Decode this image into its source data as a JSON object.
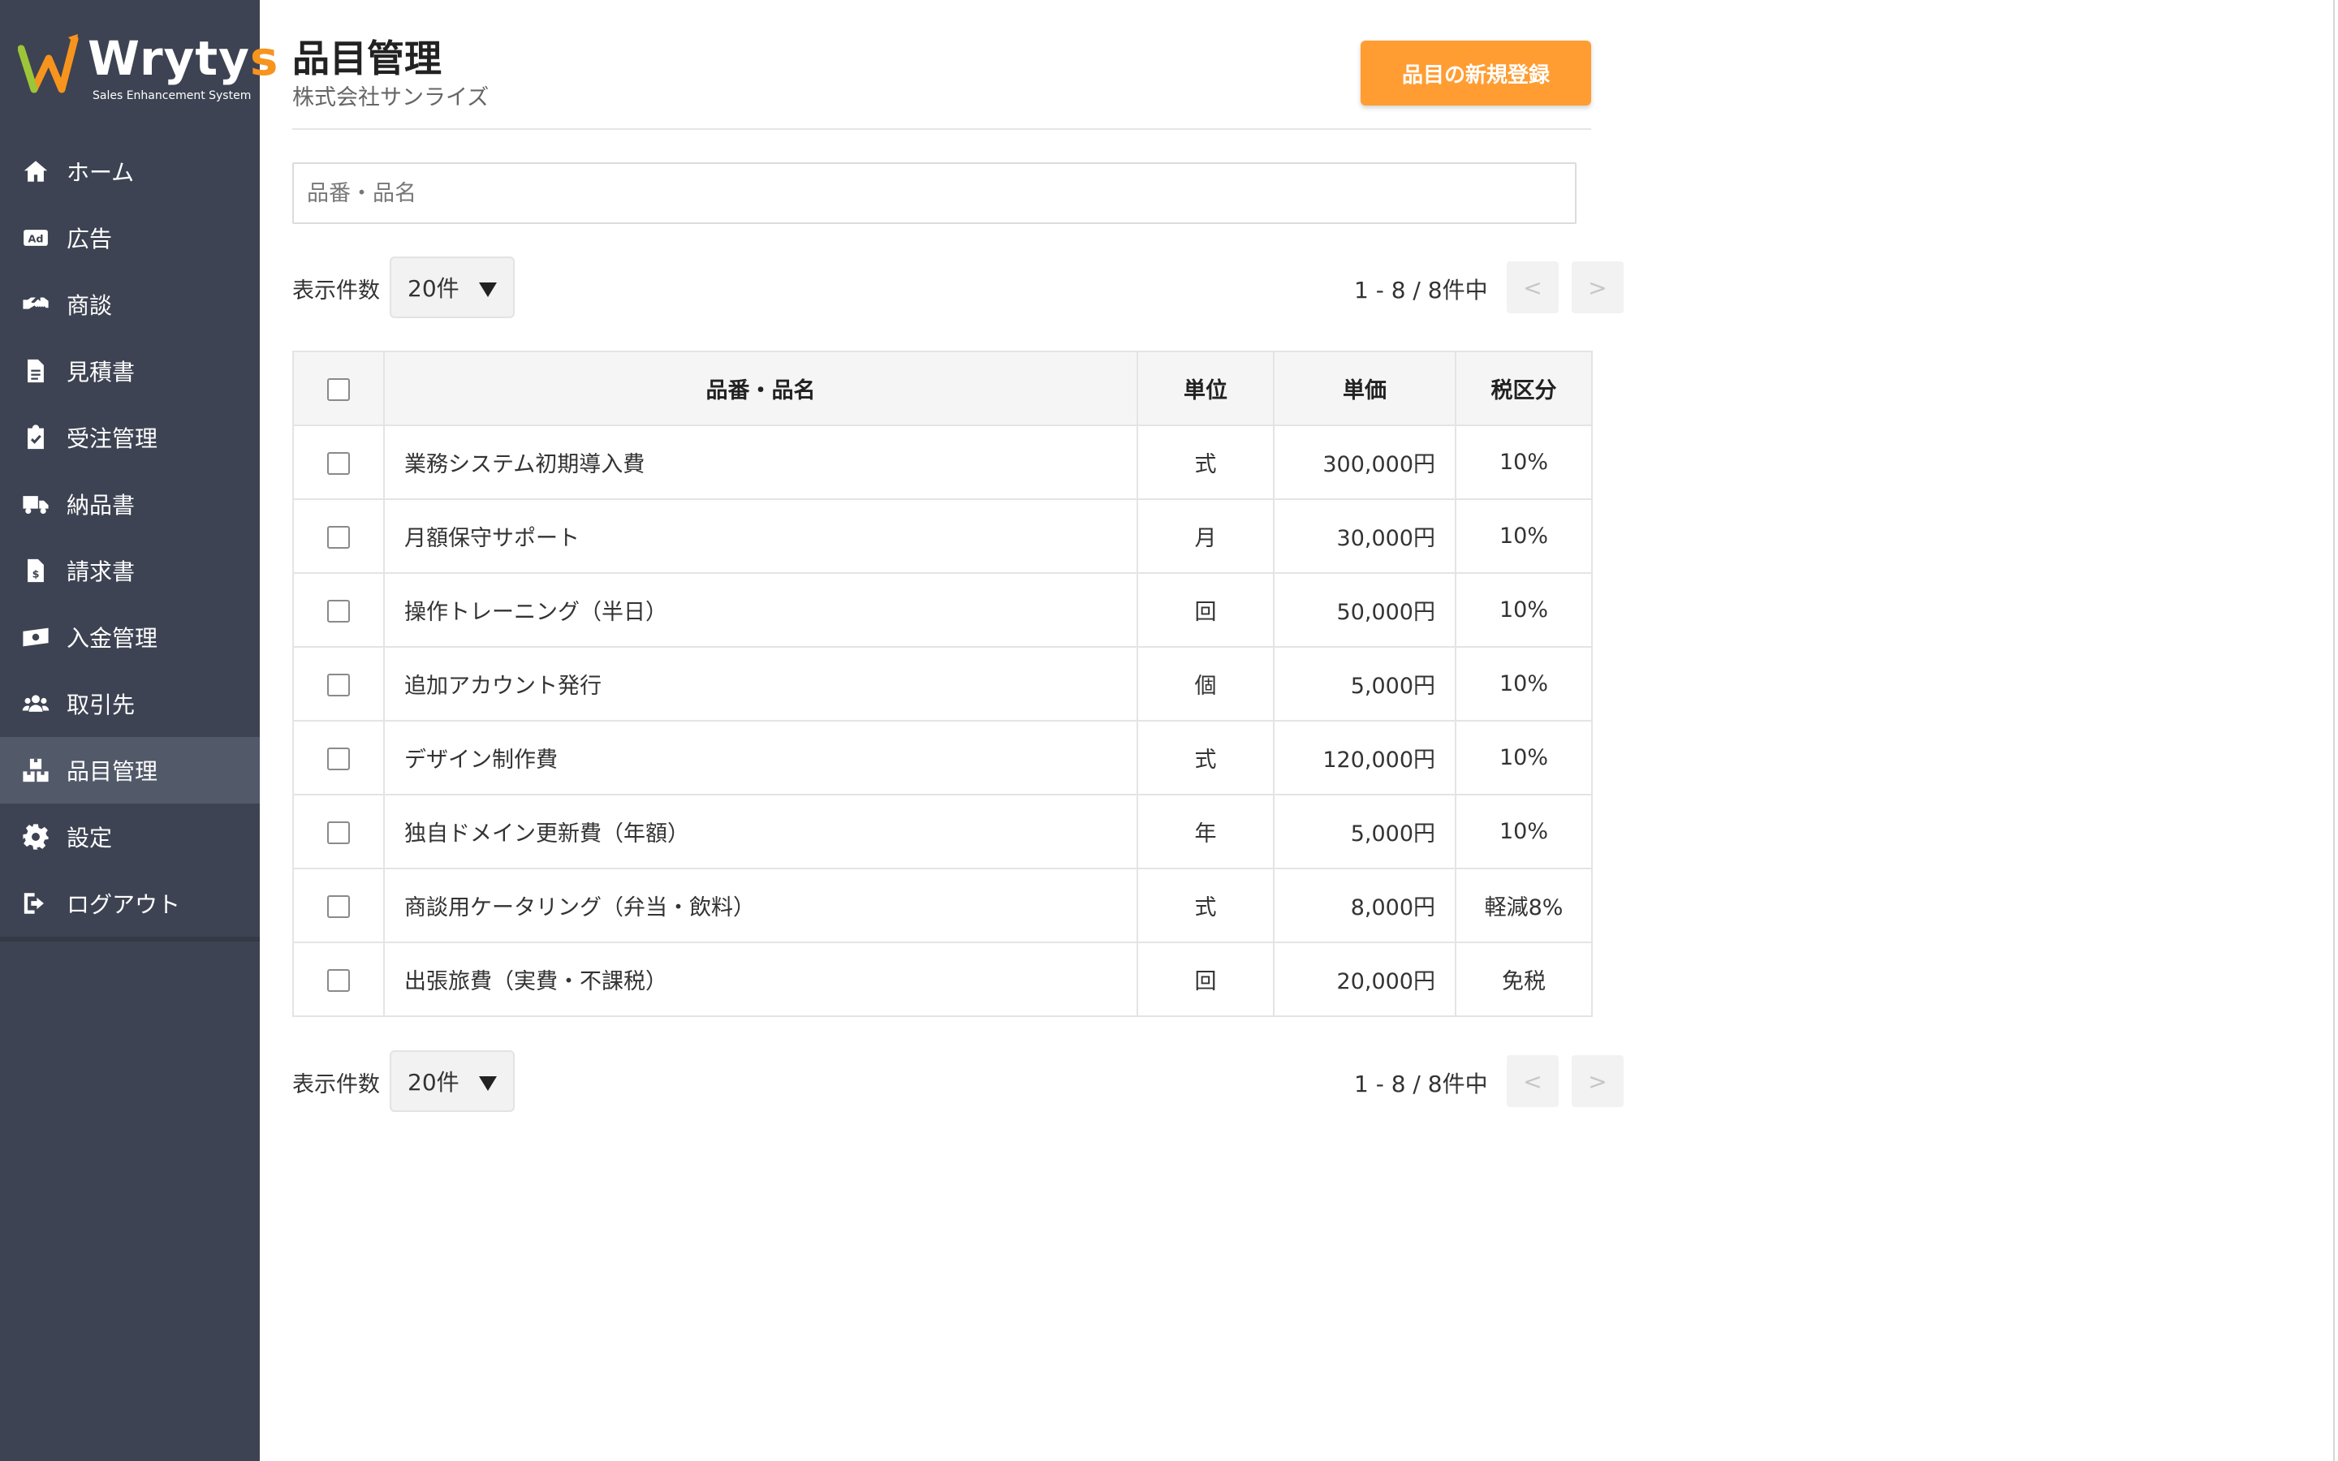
{
  "app": {
    "logo_name_main": "Wryty",
    "logo_name_accent": "s",
    "logo_subtitle": "Sales Enhancement System",
    "accent_color": "#f7941d"
  },
  "sidebar": {
    "items": [
      {
        "label": "ホーム",
        "icon": "home-icon",
        "active": false
      },
      {
        "label": "広告",
        "icon": "ad-icon",
        "active": false
      },
      {
        "label": "商談",
        "icon": "handshake-icon",
        "active": false
      },
      {
        "label": "見積書",
        "icon": "document-icon",
        "active": false
      },
      {
        "label": "受注管理",
        "icon": "clipboard-check-icon",
        "active": false
      },
      {
        "label": "納品書",
        "icon": "truck-icon",
        "active": false
      },
      {
        "label": "請求書",
        "icon": "invoice-icon",
        "active": false
      },
      {
        "label": "入金管理",
        "icon": "money-icon",
        "active": false
      },
      {
        "label": "取引先",
        "icon": "users-icon",
        "active": false
      },
      {
        "label": "品目管理",
        "icon": "boxes-icon",
        "active": true
      },
      {
        "label": "設定",
        "icon": "gear-icon",
        "active": false
      },
      {
        "label": "ログアウト",
        "icon": "logout-icon",
        "active": false
      }
    ]
  },
  "header": {
    "title": "品目管理",
    "company": "株式会社サンライズ",
    "new_button": "品目の新規登録",
    "button_color": "#ff9d33"
  },
  "search": {
    "placeholder": "品番・品名",
    "value": ""
  },
  "pagination": {
    "per_page_label": "表示件数",
    "per_page_value": "20件",
    "range_text": "1 - 8 / 8件中",
    "prev_label": "<",
    "next_label": ">"
  },
  "table": {
    "headers": {
      "name": "品番・品名",
      "unit": "単位",
      "price": "単価",
      "tax": "税区分"
    },
    "rows": [
      {
        "name": "業務システム初期導入費",
        "unit": "式",
        "price": "300,000円",
        "tax": "10%"
      },
      {
        "name": "月額保守サポート",
        "unit": "月",
        "price": "30,000円",
        "tax": "10%"
      },
      {
        "name": "操作トレーニング（半日）",
        "unit": "回",
        "price": "50,000円",
        "tax": "10%"
      },
      {
        "name": "追加アカウント発行",
        "unit": "個",
        "price": "5,000円",
        "tax": "10%"
      },
      {
        "name": "デザイン制作費",
        "unit": "式",
        "price": "120,000円",
        "tax": "10%"
      },
      {
        "name": "独自ドメイン更新費（年額）",
        "unit": "年",
        "price": "5,000円",
        "tax": "10%"
      },
      {
        "name": "商談用ケータリング（弁当・飲料）",
        "unit": "式",
        "price": "8,000円",
        "tax": "軽減8%"
      },
      {
        "name": "出張旅費（実費・不課税）",
        "unit": "回",
        "price": "20,000円",
        "tax": "免税"
      }
    ]
  }
}
